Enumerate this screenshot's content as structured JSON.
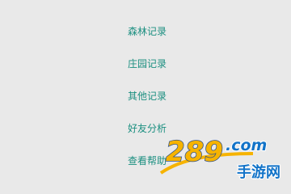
{
  "menu": {
    "items": [
      {
        "label": "森林记录"
      },
      {
        "label": "庄园记录"
      },
      {
        "label": "其他记录"
      },
      {
        "label": "好友分析"
      },
      {
        "label": "查看帮助"
      }
    ]
  },
  "watermark": {
    "brand_number": "289",
    "brand_domain": ".com",
    "brand_tagline": "手游网"
  },
  "colors": {
    "background": "#e9e9e9",
    "menu_text": "#1b8f80",
    "watermark_yellow": "#f6b300",
    "watermark_blue": "#1273c8"
  }
}
